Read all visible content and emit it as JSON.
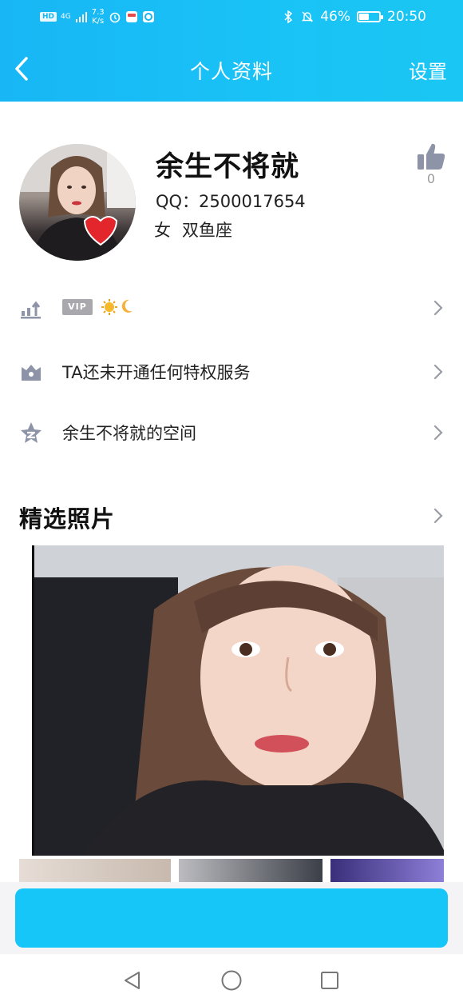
{
  "status_bar": {
    "hd": "HD",
    "network": "4G",
    "speed_value": "7.3",
    "speed_unit": "K/s",
    "battery": "46%",
    "battery_level": 0.46,
    "time": "20:50"
  },
  "header": {
    "title": "个人资料",
    "settings": "设置"
  },
  "profile": {
    "name": "余生不将就",
    "qq": "QQ：2500017654",
    "gender": "女",
    "zodiac": "双鱼座",
    "likes": "0"
  },
  "rows": {
    "level": {
      "badge": "VIP"
    },
    "privilege": {
      "label": "TA还未开通任何特权服务"
    },
    "space": {
      "label": "余生不将就的空间"
    }
  },
  "photos": {
    "title": "精选照片"
  },
  "colors": {
    "header_blue": "#19bef5",
    "action_blue": "#17c6f8",
    "icon_gray": "#8e94a8"
  }
}
